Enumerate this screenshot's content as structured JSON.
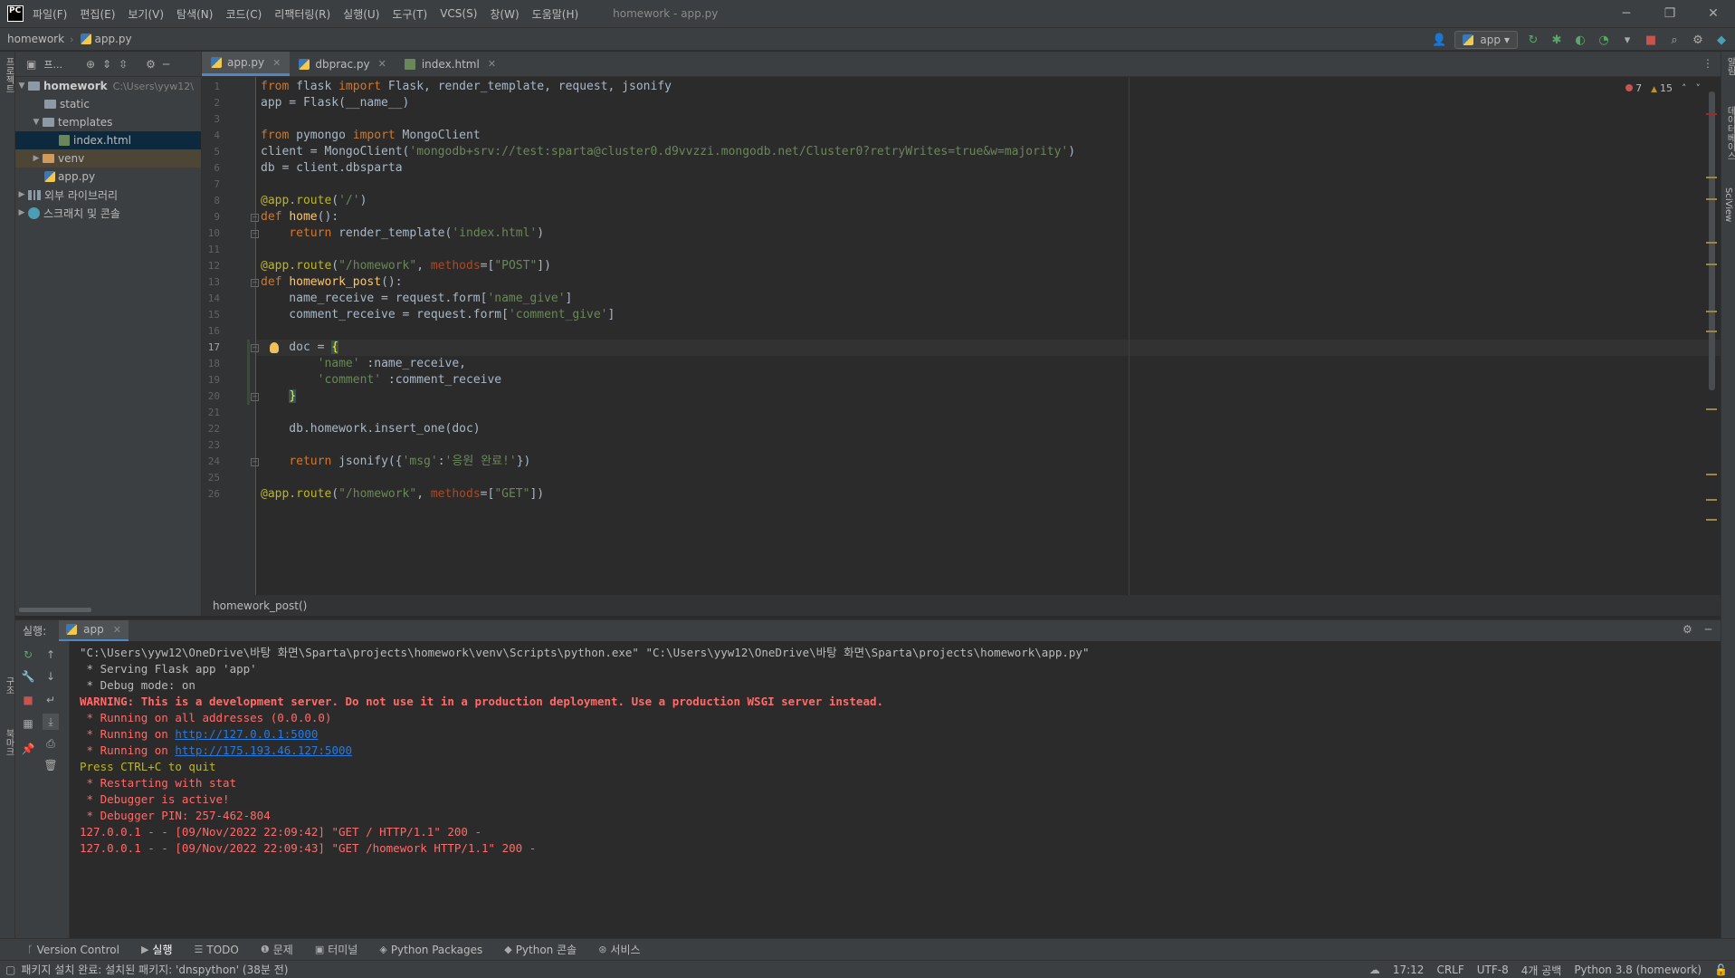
{
  "titlebar": {
    "logo": "PC",
    "menus": [
      "파일(F)",
      "편집(E)",
      "보기(V)",
      "탐색(N)",
      "코드(C)",
      "리팩터링(R)",
      "실행(U)",
      "도구(T)",
      "VCS(S)",
      "창(W)",
      "도움말(H)"
    ],
    "window_title": "homework - app.py"
  },
  "navbar": {
    "project": "homework",
    "file": "app.py",
    "run_config": "app"
  },
  "left_strip": {
    "project_label": "프로젝트",
    "structure_label": "구조",
    "bookmarks_label": "북마크"
  },
  "project_panel": {
    "toolbar_label": "프...",
    "root": "homework",
    "root_path": "C:\\Users\\yyw12\\",
    "items": [
      "static",
      "templates",
      "index.html",
      "venv",
      "app.py"
    ],
    "external_libs": "외부 라이브러리",
    "scratches": "스크래치 및 콘솔"
  },
  "tabs": [
    {
      "label": "app.py"
    },
    {
      "label": "dbprac.py"
    },
    {
      "label": "index.html"
    }
  ],
  "inspection": {
    "errors": "7",
    "warnings": "15"
  },
  "editor": {
    "current_line": 17,
    "crumb": "homework_post()"
  },
  "code_lines": [
    "from flask import Flask, render_template, request, jsonify",
    "app = Flask(__name__)",
    "",
    "from pymongo import MongoClient",
    "client = MongoClient('mongodb+srv://test:sparta@cluster0.d9vvzzi.mongodb.net/Cluster0?retryWrites=true&w=majority')",
    "db = client.dbsparta",
    "",
    "@app.route('/')",
    "def home():",
    "    return render_template('index.html')",
    "",
    "@app.route(\"/homework\", methods=[\"POST\"])",
    "def homework_post():",
    "    name_receive = request.form['name_give']",
    "    comment_receive = request.form['comment_give']",
    "",
    "    doc = {",
    "        'name' :name_receive,",
    "        'comment' :comment_receive",
    "    }",
    "",
    "    db.homework.insert_one(doc)",
    "",
    "    return jsonify({'msg':'응원 완료!'})",
    "",
    "@app.route(\"/homework\", methods=[\"GET\"])"
  ],
  "run_panel": {
    "label": "실행:",
    "tab": "app"
  },
  "console_lines": [
    {
      "text": "\"C:\\Users\\yyw12\\OneDrive\\바탕 화면\\Sparta\\projects\\homework\\venv\\Scripts\\python.exe\" \"C:\\Users\\yyw12\\OneDrive\\바탕 화면\\Sparta\\projects\\homework\\app.py\"",
      "style": "normal"
    },
    {
      "text": " * Serving Flask app 'app'",
      "style": "normal"
    },
    {
      "text": " * Debug mode: on",
      "style": "normal"
    },
    {
      "text": "WARNING: This is a development server. Do not use it in a production deployment. Use a production WSGI server instead.",
      "style": "redbold"
    },
    {
      "text": " * Running on all addresses (0.0.0.0)",
      "style": "red"
    },
    {
      "text": " * Running on ",
      "link": "http://127.0.0.1:5000",
      "style": "red"
    },
    {
      "text": " * Running on ",
      "link": "http://175.193.46.127:5000",
      "style": "red"
    },
    {
      "text": "Press CTRL+C to quit",
      "style": "yellow"
    },
    {
      "text": " * Restarting with stat",
      "style": "red"
    },
    {
      "text": " * Debugger is active!",
      "style": "red"
    },
    {
      "text": " * Debugger PIN: 257-462-804",
      "style": "red"
    },
    {
      "text": "127.0.0.1 - - [09/Nov/2022 22:09:42] \"GET / HTTP/1.1\" 200 -",
      "style": "red"
    },
    {
      "text": "127.0.0.1 - - [09/Nov/2022 22:09:43] \"GET /homework HTTP/1.1\" 200 -",
      "style": "red"
    }
  ],
  "bottom_tools": [
    {
      "icon": "vcs-icon",
      "label": "Version Control"
    },
    {
      "icon": "run-icon",
      "label": "실행"
    },
    {
      "icon": "todo-icon",
      "label": "TODO"
    },
    {
      "icon": "problems-icon",
      "label": "문제"
    },
    {
      "icon": "terminal-icon",
      "label": "터미널"
    },
    {
      "icon": "packages-icon",
      "label": "Python Packages"
    },
    {
      "icon": "python-console-icon",
      "label": "Python 콘솔"
    },
    {
      "icon": "services-icon",
      "label": "서비스"
    }
  ],
  "statusbar": {
    "message": "패키지 설치 완료: 설치된 패키지: 'dnspython' (38분 전)",
    "position": "17:12",
    "line_sep": "CRLF",
    "encoding": "UTF-8",
    "indent": "4개 공백",
    "interpreter": "Python 3.8 (homework)"
  },
  "right_strip": {
    "notifications_label": "알림",
    "database_label": "데이터베이스",
    "sciview_label": "SciView"
  },
  "colors": {
    "accent": "#4a88c7",
    "background": "#2b2b2b",
    "panel": "#3c3f41"
  }
}
